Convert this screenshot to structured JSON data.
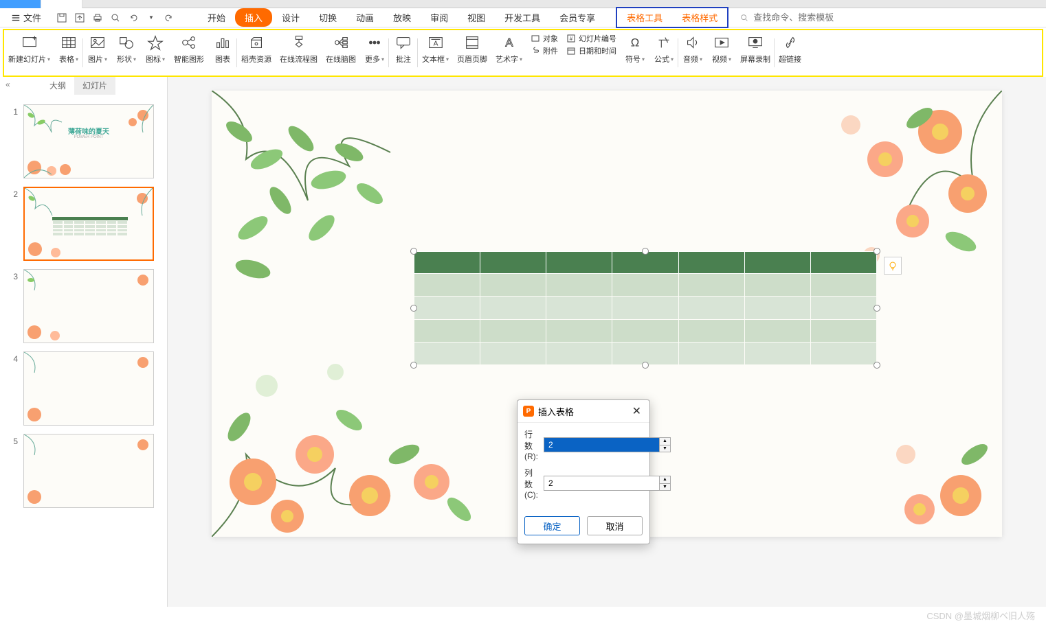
{
  "menu": {
    "file": "文件",
    "tabs": [
      "开始",
      "插入",
      "设计",
      "切换",
      "动画",
      "放映",
      "审阅",
      "视图",
      "开发工具",
      "会员专享"
    ],
    "active_tab": "插入",
    "context_tabs": [
      "表格工具",
      "表格样式"
    ],
    "search_placeholder": "查找命令、搜索模板"
  },
  "ribbon": [
    {
      "label": "新建幻灯片",
      "dropdown": true,
      "icon": "new-slide"
    },
    {
      "label": "表格",
      "dropdown": true,
      "icon": "table",
      "sep": true
    },
    {
      "label": "图片",
      "dropdown": true,
      "icon": "picture"
    },
    {
      "label": "形状",
      "dropdown": true,
      "icon": "shapes"
    },
    {
      "label": "图标",
      "dropdown": true,
      "icon": "icons"
    },
    {
      "label": "智能图形",
      "icon": "smartart"
    },
    {
      "label": "图表",
      "icon": "chart",
      "sep": true
    },
    {
      "label": "稻壳资源",
      "icon": "resource"
    },
    {
      "label": "在线流程图",
      "icon": "flowchart"
    },
    {
      "label": "在线脑图",
      "icon": "mindmap"
    },
    {
      "label": "更多",
      "dropdown": true,
      "icon": "more",
      "sep": true
    },
    {
      "label": "批注",
      "icon": "comment",
      "sep": true
    },
    {
      "label": "文本框",
      "dropdown": true,
      "icon": "textbox"
    },
    {
      "label": "页眉页脚",
      "icon": "headerfooter"
    },
    {
      "label": "艺术字",
      "dropdown": true,
      "icon": "wordart"
    }
  ],
  "ribbon_small": [
    {
      "label": "对象",
      "icon": "object"
    },
    {
      "label": "附件",
      "icon": "attachment"
    },
    {
      "label": "幻灯片编号",
      "icon": "slidenum"
    },
    {
      "label": "日期和时间",
      "icon": "datetime"
    }
  ],
  "ribbon2": [
    {
      "label": "符号",
      "dropdown": true,
      "icon": "symbol"
    },
    {
      "label": "公式",
      "dropdown": true,
      "icon": "equation",
      "sep": true
    },
    {
      "label": "音频",
      "dropdown": true,
      "icon": "audio"
    },
    {
      "label": "视频",
      "dropdown": true,
      "icon": "video"
    },
    {
      "label": "屏幕录制",
      "icon": "screenrec",
      "sep": true
    },
    {
      "label": "超链接",
      "icon": "hyperlink"
    }
  ],
  "sidebar": {
    "tabs": [
      "大纲",
      "幻灯片"
    ],
    "active_tab": "幻灯片",
    "slides": [
      1,
      2,
      3,
      4,
      5
    ],
    "active_slide": 2,
    "slide1_title": "薄荷味的夏天",
    "slide1_subtitle": "POWER POINT"
  },
  "dialog": {
    "title": "插入表格",
    "rows_label": "行数(R):",
    "rows_value": "2",
    "cols_label": "列数(C):",
    "cols_value": "2",
    "ok": "确定",
    "cancel": "取消"
  },
  "watermark": "CSDN @墨城烟柳ベ旧人殇"
}
